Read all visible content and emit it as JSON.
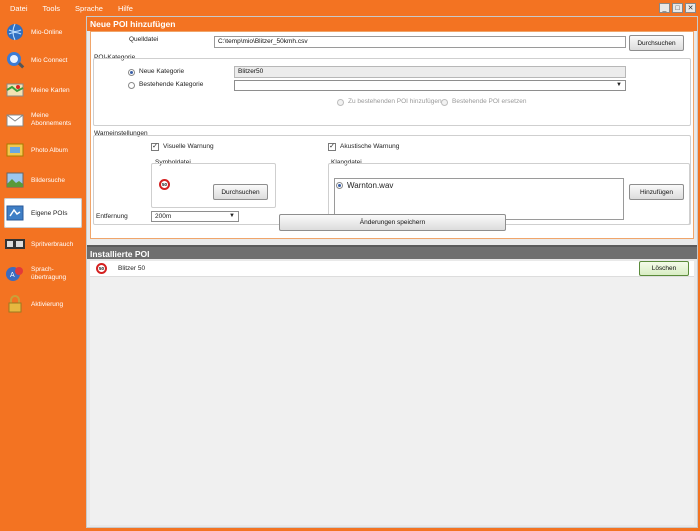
{
  "menu": [
    "Datei",
    "Tools",
    "Sprache",
    "Hilfe"
  ],
  "window_controls": {
    "minimize": "_",
    "maximize": "□",
    "close": "✕"
  },
  "sidebar": {
    "items": [
      {
        "label": "Mio-Online",
        "icon": "globe-icon"
      },
      {
        "label": "Mio Connect",
        "icon": "satellite-icon"
      },
      {
        "label": "Meine Karten",
        "icon": "map-icon"
      },
      {
        "label": "Meine Abonnements",
        "icon": "envelope-icon"
      },
      {
        "label": "Photo Album",
        "icon": "photo-album-icon"
      },
      {
        "label": "Bildersuche",
        "icon": "picture-search-icon"
      },
      {
        "label": "Eigene POIs",
        "icon": "poi-icon"
      },
      {
        "label": "Spritverbrauch",
        "icon": "fuel-gauge-icon"
      },
      {
        "label": "Sprach-übertragung",
        "icon": "speech-icon"
      },
      {
        "label": "Aktivierung",
        "icon": "lock-icon"
      }
    ],
    "active": "Eigene POIs"
  },
  "new_poi": {
    "title": "Neue POI hinzufügen",
    "source_label": "Quelldatei",
    "source_value": "C:\\temp\\mio\\Blitzer_50kmh.csv",
    "browse_button": "Durchsuchen",
    "category_group": "POI-Kategorie",
    "new_category_label": "Neue Kategorie",
    "new_category_value": "Blitzer50",
    "existing_category_label": "Bestehende Kategorie",
    "existing_category_value": "",
    "add_to_existing": "Zu bestehenden POI hinzufügen",
    "replace_existing": "Bestehende POI ersetzen",
    "warning_group": "Warneinstellungen",
    "visual_warning": "Visuelle Warnung",
    "acoustic_warning": "Akustische Warnung",
    "symbol_group": "Symboldatei",
    "symbol_sign": "50",
    "symbol_browse": "Durchsuchen",
    "sound_group": "Klangdatei",
    "sound_file": "Warnton.wav",
    "sound_add": "Hinzufügen",
    "distance_label": "Entfernung",
    "distance_value": "200m",
    "save_button": "Änderungen speichern"
  },
  "installed": {
    "title": "Installierte POI",
    "rows": [
      {
        "sign": "50",
        "name": "Blitzer 50",
        "delete": "Löschen"
      }
    ]
  }
}
